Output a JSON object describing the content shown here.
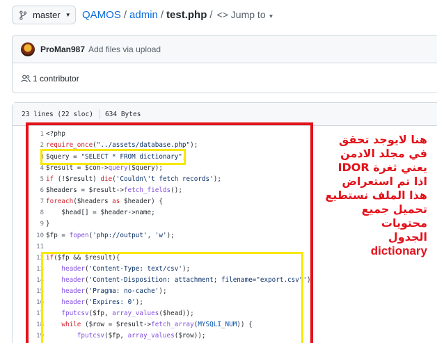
{
  "branch": {
    "name": "master"
  },
  "breadcrumb": {
    "repo": "QAMOS",
    "sep": "/",
    "folder": "admin",
    "file": "test.php",
    "jump": "<> Jump to"
  },
  "commit": {
    "author": "ProMan987",
    "message": "Add files via upload"
  },
  "contributors": {
    "label": "1 contributor"
  },
  "file_info": {
    "lines": "23 lines (22 sloc)",
    "size": "634 Bytes"
  },
  "annotation": {
    "lines": [
      "هنا لايوجد تحقق",
      "في مجلد الادمن",
      "يعني ثغرة IDOR",
      "اذا تم استعراض",
      "هذا الملف نستطيع",
      "تحميل جميع محتويات",
      "الجدول",
      "dictionary"
    ]
  },
  "code": [
    {
      "n": "1",
      "t": "<?php"
    },
    {
      "n": "2",
      "t": "require_once(\"../assets/database.php\");"
    },
    {
      "n": "3",
      "t": "$query = \"SELECT * FROM dictionary\";"
    },
    {
      "n": "4",
      "t": "$result = $con->query($query);"
    },
    {
      "n": "5",
      "t": "if (!$result) die('Couldn\\'t fetch records');"
    },
    {
      "n": "6",
      "t": "$headers = $result->fetch_fields();"
    },
    {
      "n": "7",
      "t": "foreach($headers as $header) {"
    },
    {
      "n": "8",
      "t": "    $head[] = $header->name;"
    },
    {
      "n": "9",
      "t": "}"
    },
    {
      "n": "10",
      "t": "$fp = fopen('php://output', 'w');"
    },
    {
      "n": "11",
      "t": ""
    },
    {
      "n": "12",
      "t": "if($fp && $result){"
    },
    {
      "n": "13",
      "t": "    header('Content-Type: text/csv');"
    },
    {
      "n": "14",
      "t": "    header('Content-Disposition: attachment; filename=\"export.csv\"');"
    },
    {
      "n": "15",
      "t": "    header('Pragma: no-cache');"
    },
    {
      "n": "16",
      "t": "    header('Expires: 0');"
    },
    {
      "n": "17",
      "t": "    fputcsv($fp, array_values($head));"
    },
    {
      "n": "18",
      "t": "    while ($row = $result->fetch_array(MYSQLI_NUM)) {"
    },
    {
      "n": "19",
      "t": "        fputcsv($fp, array_values($row));"
    }
  ],
  "colors": {
    "highlight_red": "#e3121b",
    "highlight_yellow": "#f8e800",
    "link": "#0969da"
  }
}
